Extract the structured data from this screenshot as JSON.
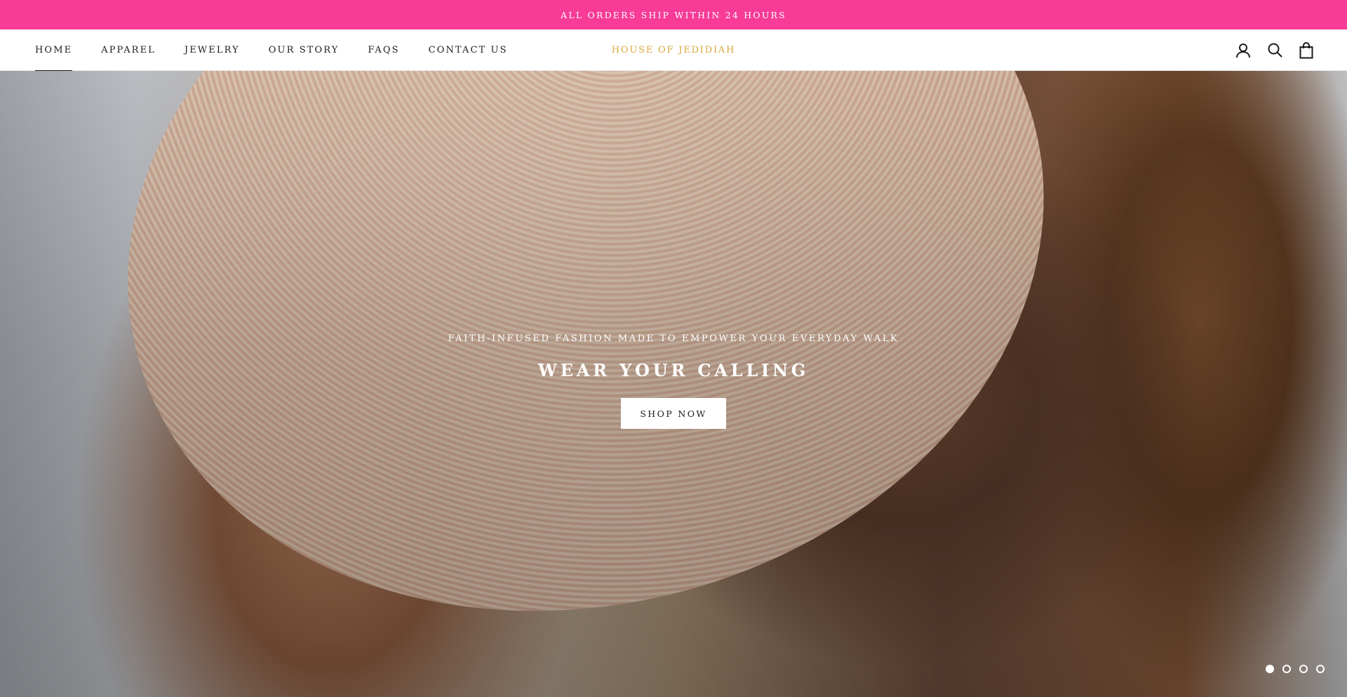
{
  "announcement": {
    "text": "ALL ORDERS SHIP WITHIN 24 HOURS"
  },
  "header": {
    "nav": [
      {
        "label": "HOME",
        "active": true
      },
      {
        "label": "APPAREL",
        "active": false
      },
      {
        "label": "JEWELRY",
        "active": false
      },
      {
        "label": "OUR STORY",
        "active": false
      },
      {
        "label": "FAQS",
        "active": false
      },
      {
        "label": "CONTACT US",
        "active": false
      }
    ],
    "logo": "HOUSE OF JEDIDIAH",
    "icons": [
      "account-icon",
      "search-icon",
      "cart-icon"
    ]
  },
  "hero": {
    "subtitle": "FAITH-INFUSED FASHION MADE TO EMPOWER YOUR EVERYDAY WALK",
    "title": "WEAR YOUR CALLING",
    "button_label": "SHOP NOW",
    "slides": {
      "count": 4,
      "active_index": 0
    }
  },
  "colors": {
    "announcement_bg": "#f73b97",
    "logo": "#d8a83c",
    "text": "#1c1b1b"
  }
}
